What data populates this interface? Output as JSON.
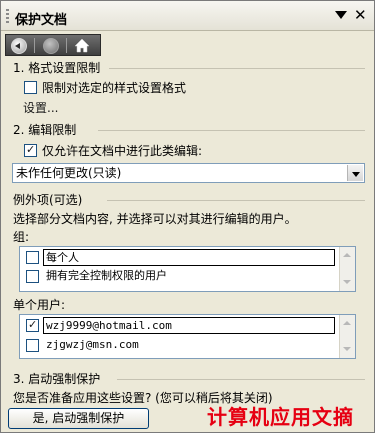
{
  "pane": {
    "title": "保护文档"
  },
  "section1": {
    "heading": "1. 格式设置限制",
    "checkbox_label": "限制对选定的样式设置格式",
    "checkbox_checked": false,
    "settings_link": "设置..."
  },
  "section2": {
    "heading": "2. 编辑限制",
    "checkbox_label": "仅允许在文档中进行此类编辑:",
    "checkbox_checked": true,
    "edit_type_value": "未作任何更改(只读)",
    "exceptions_heading": "例外项(可选)",
    "exceptions_description": "选择部分文档内容, 并选择可以对其进行编辑的用户。",
    "groups_label": "组:",
    "groups": [
      {
        "label": "每个人",
        "checked": false
      },
      {
        "label": "拥有完全控制权限的用户",
        "checked": false
      }
    ],
    "individuals_label": "单个用户:",
    "individuals": [
      {
        "label": "wzj9999@hotmail.com",
        "checked": true
      },
      {
        "label": "zjgwzj@msn.com",
        "checked": false
      }
    ]
  },
  "section3": {
    "heading": "3. 启动强制保护",
    "description": "您是否准备应用这些设置? (您可以稍后将其关闭)",
    "start_button_label": "是, 启动强制保护"
  },
  "watermark": {
    "text": "计算机应用文摘",
    "color": "#e60012"
  }
}
